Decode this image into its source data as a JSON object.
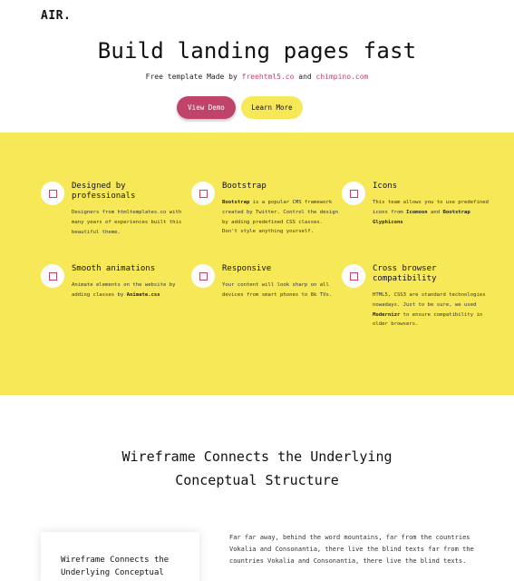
{
  "header": {
    "logo": "AIR."
  },
  "hero": {
    "title": "Build landing pages fast",
    "subtitle_prefix": "Free template Made by ",
    "link1": "freehtml5.co",
    "subtitle_mid": " and ",
    "link2": "chimpino.com",
    "primary_button": "View Demo",
    "secondary_button": "Learn More"
  },
  "features": [
    {
      "title": "Designed by professionals",
      "desc_html": "Designers from htmltemplates.co with many years of experiences built this beautiful theme.",
      "icon": "square-outline-icon"
    },
    {
      "title": "Bootstrap",
      "desc_bold": "Bootstrap",
      "desc_rest": " is a popular CMS framework created by Twitter. Control the design by adding predefined CSS classes. Don't style anything yourself.",
      "icon": "square-outline-icon"
    },
    {
      "title": "Icons",
      "desc_pre": "This team allows you to use predefined icons from ",
      "desc_b1": "Icomoon",
      "desc_mid": " and ",
      "desc_b2": "Bootstrap Glyphicons",
      "icon": "square-outline-icon"
    },
    {
      "title": "Smooth animations",
      "desc_pre": "Animate elements on the website by adding classes by ",
      "desc_b1": "Animate.css",
      "icon": "square-outline-icon"
    },
    {
      "title": "Responsive",
      "desc": "Your content will look sharp on all devices from smart phones to 8k TVs.",
      "icon": "square-outline-icon"
    },
    {
      "title": "Cross browser compatibility",
      "desc_pre": "HTML5, CSS3 are standard technologies nowadays. Just to be sure, we used ",
      "desc_b1": "Modernizr",
      "desc_rest": " to ensure compatibility in older browsers.",
      "icon": "square-outline-icon"
    }
  ],
  "section2": {
    "title_line1": "Wireframe Connects the Underlying",
    "title_line2": "Conceptual Structure",
    "card_title": "Wireframe Connects the Underlying Conceptual",
    "paragraph": "Far far away, behind the word mountains, far from the countries Vokalia and Consonantia, there live the blind texts far from the countries Vokalia and Consonantia, there live the blind texts."
  },
  "colors": {
    "accent": "#c0436a",
    "yellow": "#f7e857"
  }
}
